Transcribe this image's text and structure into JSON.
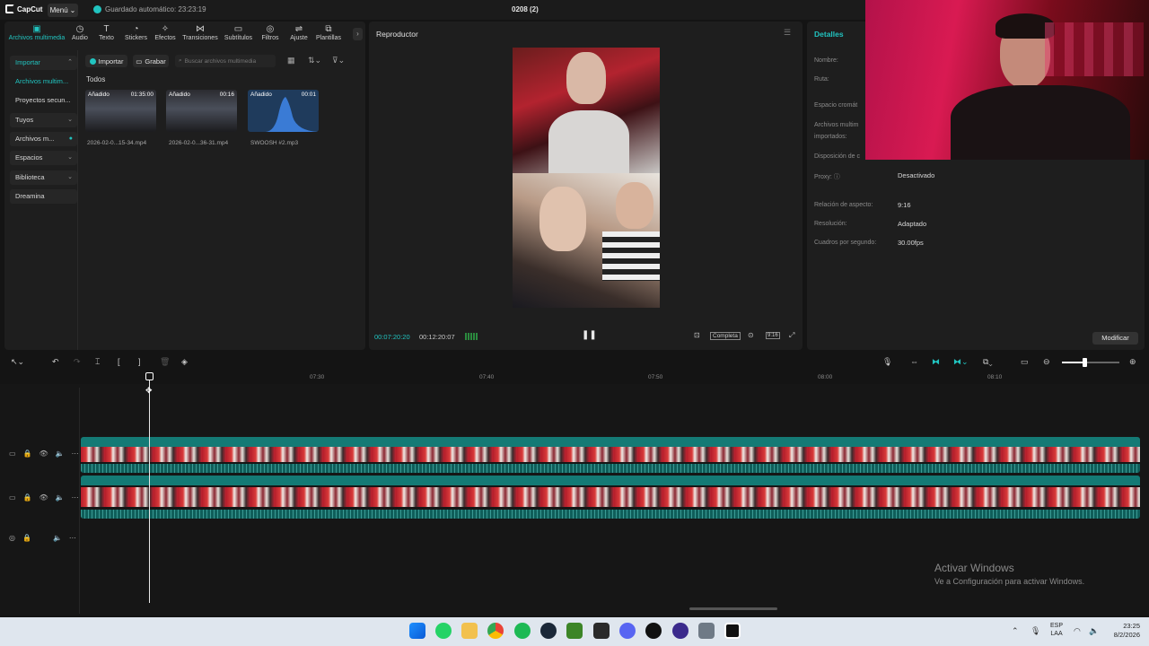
{
  "app": {
    "logo": "CapCut",
    "menu_label": "Menú",
    "autosave": "Guardado automático: 23:23:19",
    "project_title": "0208 (2)"
  },
  "toolbar_tabs": [
    {
      "label": "Archivos multimedia",
      "icon": "media-icon",
      "glyph": "▣"
    },
    {
      "label": "Audio",
      "icon": "audio-icon",
      "glyph": "◷"
    },
    {
      "label": "Texto",
      "icon": "text-icon",
      "glyph": "T"
    },
    {
      "label": "Stickers",
      "icon": "sticker-icon",
      "glyph": "◔"
    },
    {
      "label": "Efectos",
      "icon": "effects-icon",
      "glyph": "✧"
    },
    {
      "label": "Transiciones",
      "icon": "transitions-icon",
      "glyph": "⋈"
    },
    {
      "label": "Subtítulos",
      "icon": "subtitles-icon",
      "glyph": "▭"
    },
    {
      "label": "Filtros",
      "icon": "filters-icon",
      "glyph": "◎"
    },
    {
      "label": "Ajuste",
      "icon": "adjust-icon",
      "glyph": "⇌"
    },
    {
      "label": "Plantillas",
      "icon": "templates-icon",
      "glyph": "⧉"
    }
  ],
  "left_nav": {
    "import": "Importar",
    "media": "Archivos multim...",
    "secondary": "Proyectos secun...",
    "yours": "Tuyos",
    "media2": "Archivos m...",
    "spaces": "Espacios",
    "library": "Biblioteca",
    "dreamina": "Dreamina"
  },
  "media_toolbar": {
    "import": "Importar",
    "record": "Grabar",
    "search_placeholder": "Buscar archivos multimedia",
    "all": "Todos"
  },
  "media_items": [
    {
      "tag": "Añadido",
      "duration": "01:35:00",
      "name": "2026-02-0...15-34.mp4"
    },
    {
      "tag": "Añadido",
      "duration": "00:16",
      "name": "2026-02-0...36-31.mp4"
    },
    {
      "tag": "Añadido",
      "duration": "00:01",
      "name": "SWOOSH #2.mp3"
    }
  ],
  "player": {
    "title": "Reproductor",
    "time_current": "00:07:20:20",
    "time_total": "00:12:20:07",
    "full_label": "Completa",
    "ratio_label": "9:16"
  },
  "details": {
    "title": "Detalles",
    "rows": [
      {
        "key": "Nombre:",
        "value": ""
      },
      {
        "key": "Ruta:",
        "value": ""
      },
      {
        "key": "Espacio cromát",
        "value": ""
      },
      {
        "key": "Archivos multim",
        "value": ""
      },
      {
        "key": "importados:",
        "value": ""
      },
      {
        "key": "Disposición de c",
        "value": ""
      },
      {
        "key": "Proxy:",
        "value": "Desactivado"
      },
      {
        "key": "Relación de aspecto:",
        "value": "9:16"
      },
      {
        "key": "Resolución:",
        "value": "Adaptado"
      },
      {
        "key": "Cuadros por segundo:",
        "value": "30.00fps"
      }
    ],
    "modify": "Modificar"
  },
  "timeline": {
    "ruler": [
      "07:30",
      "07:40",
      "07:50",
      "08:00",
      "08:10"
    ]
  },
  "watermark": {
    "title": "Activar Windows",
    "subtitle": "Ve a Configuración para activar Windows."
  },
  "taskbar": {
    "lang1": "ESP",
    "lang2": "LAA",
    "time": "23:25",
    "date": "8/2/2026"
  },
  "colors": {
    "accent": "#21c4c0",
    "background": "#141414",
    "panel": "#1e1e1e",
    "clip_teal": "#147a75"
  }
}
